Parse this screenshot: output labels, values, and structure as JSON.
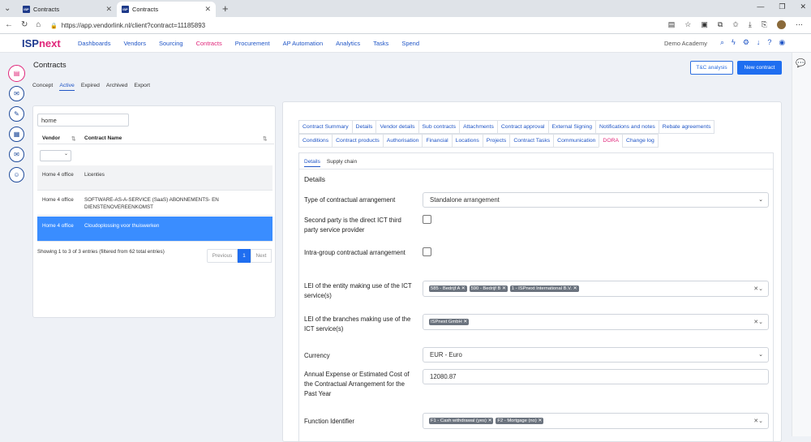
{
  "browser": {
    "tabs": [
      {
        "label": "Contracts"
      },
      {
        "label": "Contracts"
      }
    ],
    "fav_text": "ISP",
    "url": "https://app.vendorlink.nl/client?contract=11185893"
  },
  "app": {
    "logo_isp": "ISP",
    "logo_next": "next",
    "nav": [
      "Dashboards",
      "Vendors",
      "Sourcing",
      "Contracts",
      "Procurement",
      "AP Automation",
      "Analytics",
      "Tasks",
      "Spend"
    ],
    "academy": "Demo Academy"
  },
  "page": {
    "title": "Contracts",
    "subtabs": [
      "Concept",
      "Active",
      "Expired",
      "Archived",
      "Export"
    ],
    "tc_button": "T&C analysis",
    "new_button": "New contract"
  },
  "list": {
    "search_value": "home",
    "col_vendor": "Vendor",
    "col_name": "Contract Name",
    "rows": [
      {
        "vendor": "Home 4 office",
        "name": "Licenties"
      },
      {
        "vendor": "Home 4 office",
        "name": "SOFTWARE-AS-A-SERVICE (SaaS) ABONNEMENTS- EN DIENSTENOVEREENKOMST"
      },
      {
        "vendor": "Home 4 office",
        "name": "Cloudoplossing voor thuiswerken"
      }
    ],
    "info": "Showing 1 to 3 of 3 entries (filtered from 62 total entries)",
    "prev": "Previous",
    "page": "1",
    "next": "Next"
  },
  "detail": {
    "tabs_row1": [
      "Contract Summary",
      "Details",
      "Vendor details",
      "Sub contracts",
      "Attachments",
      "Contract approval",
      "External Signing",
      "Notifications and notes",
      "Rebate agreements"
    ],
    "tabs_row2": [
      "Conditions",
      "Contract products",
      "Authorisation",
      "Financial",
      "Locations",
      "Projects",
      "Contract Tasks",
      "Communication",
      "DORA",
      "Change log"
    ],
    "subtabs": [
      "Details",
      "Supply chain"
    ],
    "section_title": "Details",
    "fields": {
      "arrangement_label": "Type of contractual arrangement",
      "arrangement_value": "Standalone arrangement",
      "second_party_label": "Second party is the direct ICT third party service provider",
      "intra_group_label": "Intra-group contractual arrangement",
      "lei_entity_label": "LEI of the entity making use of the ICT service(s)",
      "lei_entity_chips": [
        "585 - Bedrijf A",
        "590 - Bedrijf B",
        "1 - ISPnext International B.V."
      ],
      "lei_branch_label": "LEI of the branches making use of the ICT service(s)",
      "lei_branch_chips": [
        "ISPnext GmbH"
      ],
      "currency_label": "Currency",
      "currency_value": "EUR - Euro",
      "expense_label": "Annual Expense or Estimated Cost of the Contractual Arrangement for the Past Year",
      "expense_value": "12080.87",
      "function_label": "Function Identifier",
      "function_chips": [
        "F1 - Cash withdrawal (yes)",
        "F2 - Mortgage (no)"
      ]
    }
  },
  "colors": {
    "brand_blue": "#1f3a8f",
    "accent_pink": "#e0267a",
    "primary": "#1f6ef0"
  }
}
